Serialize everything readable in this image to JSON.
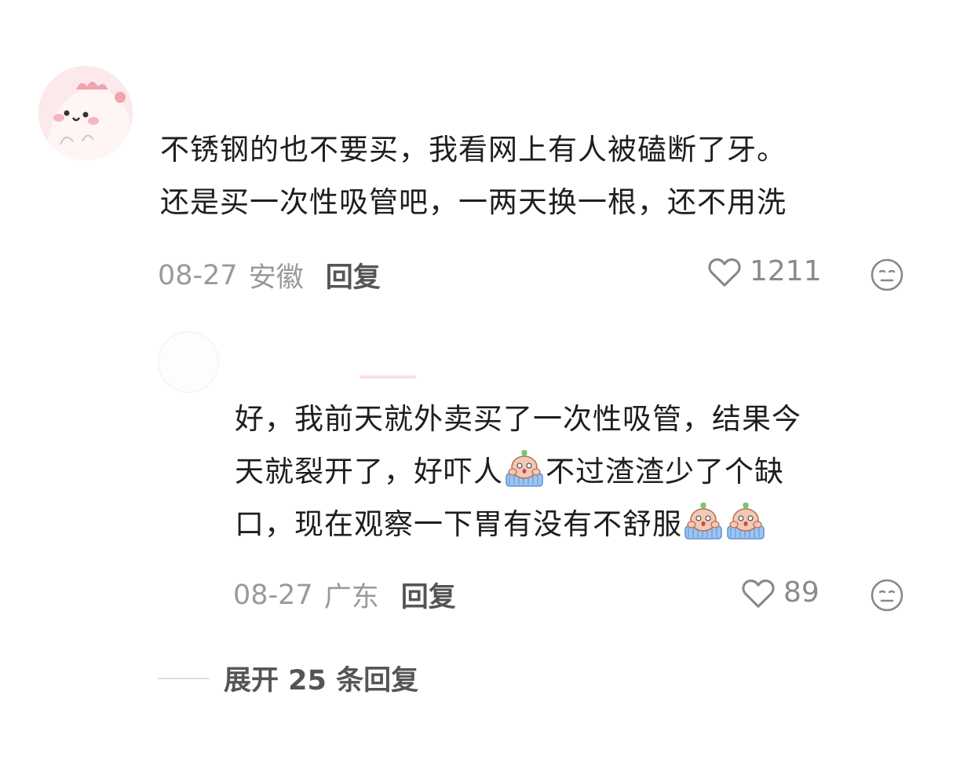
{
  "comment": {
    "avatar": "pink-cartoon-avatar",
    "lines": [
      "不锈钢的也不要买，我看网上有人被磕断了牙。",
      "还是买一次性吸管吧，一两天换一根，还不用洗"
    ],
    "date": "08-27",
    "location": "安徽",
    "reply_label": "回复",
    "likes": "1211",
    "like_icon": "heart-outline-icon",
    "emoji_icon": "meh-face-icon"
  },
  "reply": {
    "avatar": "blank-avatar",
    "lines": [
      "好，我前天就外卖买了一次性吸管，结果今",
      "天就裂开了，好吓人",
      "不过渣渣少了个缺",
      "口，现在观察一下胃有没有不舒服"
    ],
    "inline_emoji": "crying-sticker-icon",
    "date": "08-27",
    "location": "广东",
    "reply_label": "回复",
    "likes": "89",
    "like_icon": "heart-outline-icon",
    "emoji_icon": "meh-face-icon"
  },
  "expand": {
    "label": "展开 25 条回复"
  }
}
